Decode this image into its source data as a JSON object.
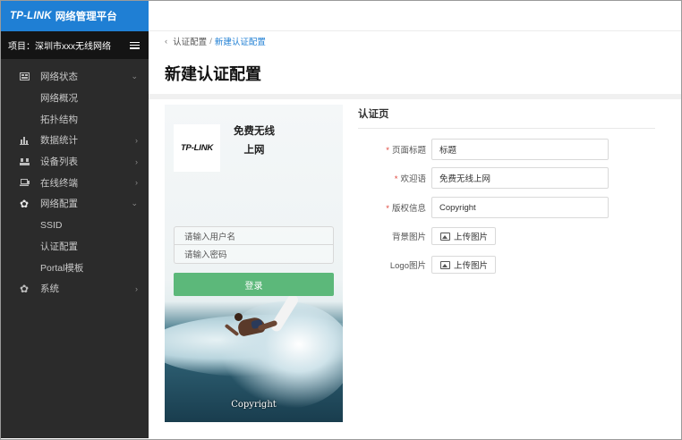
{
  "brand": {
    "logo": "TP-LINK",
    "title": "网络管理平台"
  },
  "project": {
    "label": "项目：深圳市xxx无线网络"
  },
  "sidebar": {
    "items": [
      {
        "label": "网络状态",
        "icon": "dashboard-icon",
        "chevron": "⌄"
      },
      {
        "label": "网络概况",
        "sub": true
      },
      {
        "label": "拓扑结构",
        "sub": true
      },
      {
        "label": "数据统计",
        "icon": "bar-chart-icon",
        "chevron": "›"
      },
      {
        "label": "设备列表",
        "icon": "device-icon",
        "chevron": "›"
      },
      {
        "label": "在线终端",
        "icon": "laptop-icon",
        "chevron": "›"
      },
      {
        "label": "网络配置",
        "icon": "gear-icon",
        "chevron": "⌄"
      },
      {
        "label": "SSID",
        "sub": true
      },
      {
        "label": "认证配置",
        "sub": true
      },
      {
        "label": "Portal模板",
        "sub": true
      },
      {
        "label": "系统",
        "icon": "gear-icon",
        "chevron": "›"
      }
    ]
  },
  "breadcrumb": {
    "back": "‹",
    "parent": "认证配置",
    "separator": "/",
    "current": "新建认证配置"
  },
  "page": {
    "title": "新建认证配置"
  },
  "preview": {
    "logo": "TP-LINK",
    "welcome": "免费无线上网",
    "welcome_line1": "免费无线",
    "welcome_line2": "上网",
    "username_placeholder": "请输入用户名",
    "password_placeholder": "请输入密码",
    "login_label": "登录",
    "copyright": "Copyright"
  },
  "form": {
    "section_title": "认证页",
    "required_mark": "*",
    "page_title_label": "页面标题",
    "page_title_value": "标题",
    "welcome_label": "欢迎语",
    "welcome_value": "免费无线上网",
    "copyright_label": "版权信息",
    "copyright_value": "Copyright",
    "bg_label": "背景图片",
    "bg_button": "上传图片",
    "logo_label": "Logo图片",
    "logo_button": "上传图片"
  },
  "colors": {
    "brand_blue": "#1f7fd4",
    "sidebar_bg": "#2b2b2b",
    "login_green": "#5cb87a",
    "required_red": "#e0463c"
  }
}
